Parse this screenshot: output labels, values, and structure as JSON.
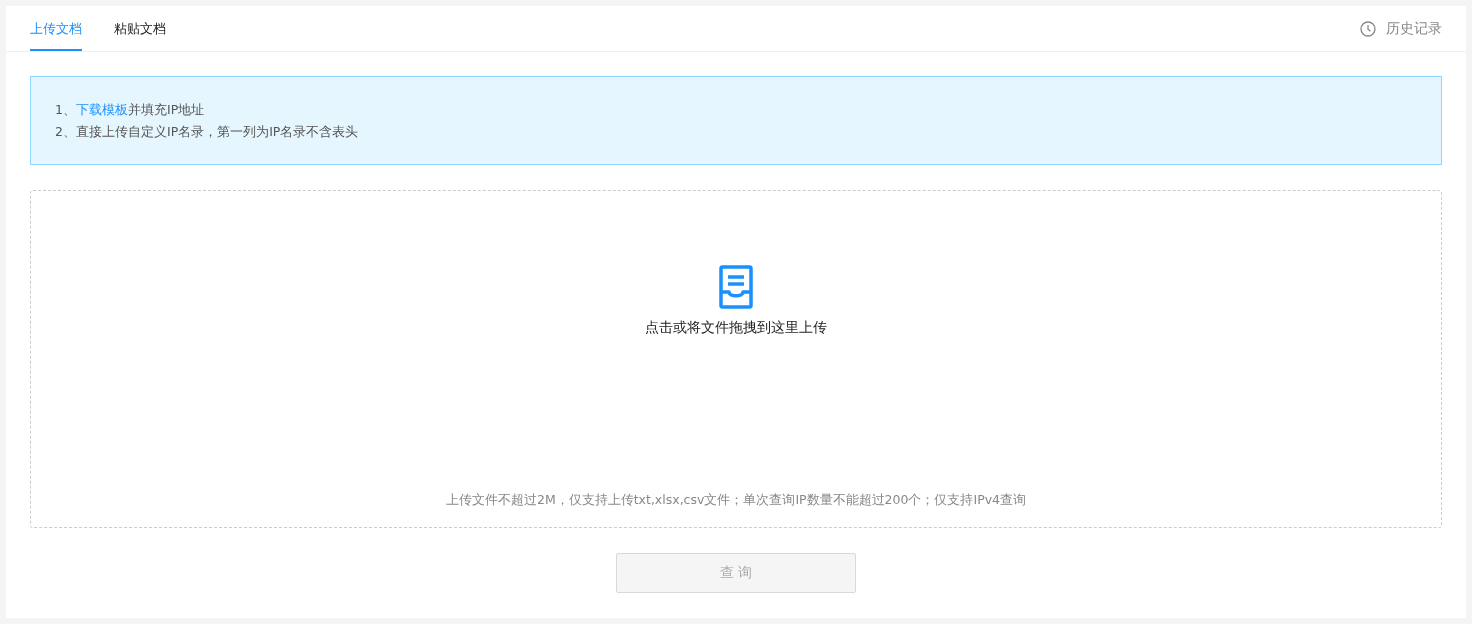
{
  "tabs": [
    {
      "label": "上传文档",
      "selected": true
    },
    {
      "label": "粘贴文档",
      "selected": false
    }
  ],
  "history": {
    "label": "历史记录"
  },
  "notice": {
    "lines": [
      {
        "prefix": "1、",
        "link": "下载模板",
        "suffix": "并填充IP地址"
      },
      {
        "prefix": "2、直接上传自定义IP名录，第一列为IP名录不含表头"
      }
    ]
  },
  "dropzone": {
    "prompt": "点击或将文件拖拽到这里上传",
    "hint": "上传文件不超过2M，仅支持上传txt,xlsx,csv文件；单次查询IP数量不能超过200个；仅支持IPv4查询"
  },
  "submit": {
    "label": "查 询",
    "disabled": true
  }
}
